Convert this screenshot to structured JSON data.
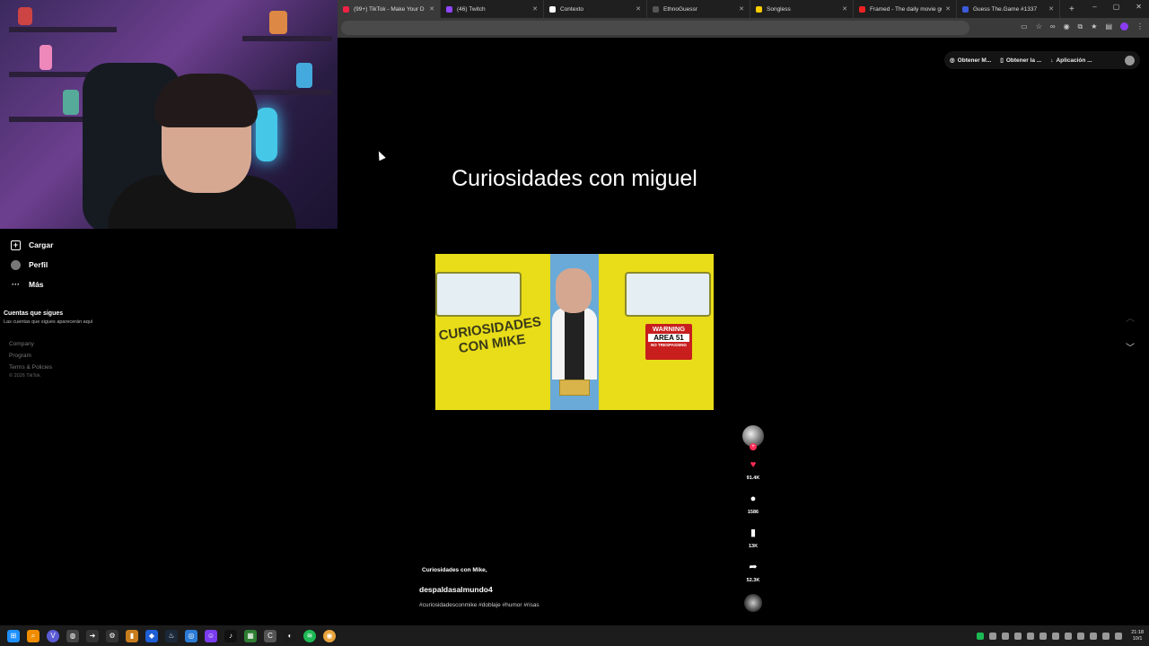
{
  "browser": {
    "tabs": [
      {
        "label": "(99+) TikTok - Make Your D",
        "color": "#e24",
        "active": true
      },
      {
        "label": "(46) Twitch",
        "color": "#9146ff",
        "active": false
      },
      {
        "label": "Contexto",
        "color": "#fff",
        "active": false
      },
      {
        "label": "EthnoGuessr",
        "color": "#555",
        "active": false
      },
      {
        "label": "Songless",
        "color": "#ffcc00",
        "active": false
      },
      {
        "label": "Framed - The daily movie gu",
        "color": "#e22",
        "active": false
      },
      {
        "label": "Guess The.Game #1337",
        "color": "#3b5bdb",
        "active": false
      }
    ],
    "new_tab": "+",
    "window_controls": {
      "minimize": "–",
      "maximize": "▢",
      "close": "✕"
    }
  },
  "extensions": {
    "items": [
      "Obtener M...",
      "Obtener la ...",
      "Aplicación ..."
    ]
  },
  "sidebar": {
    "items": [
      {
        "label": "Cargar",
        "icon": "upload-icon"
      },
      {
        "label": "Perfil",
        "icon": "avatar-icon"
      },
      {
        "label": "Más",
        "icon": "more-icon"
      }
    ],
    "following_title": "Cuentas que sigues",
    "following_desc": "Las cuentas que sigues aparecerán aquí",
    "footer_links": [
      "Company",
      "Program",
      "Terms & Policies"
    ],
    "copyright": "© 2026 TikTok"
  },
  "main": {
    "title": "Curiosidades con miguel",
    "video_overlay_text": "CURIOSIDADES CON MIKE",
    "warning_sign": {
      "line1": "WARNING",
      "line2": "AREA 51",
      "line3": "NO TRESPASSING"
    }
  },
  "actions": {
    "likes": "91.4K",
    "comments": "1586",
    "saves": "13K",
    "shares": "52.3K"
  },
  "caption": {
    "title": "Curiosidades con Mike,",
    "username": "despaldasalmundo4",
    "hashtags": "#curiosidadesconmike #doblaje #humor #risas"
  },
  "taskbar": {
    "time": "21:18",
    "date": "10/1"
  }
}
